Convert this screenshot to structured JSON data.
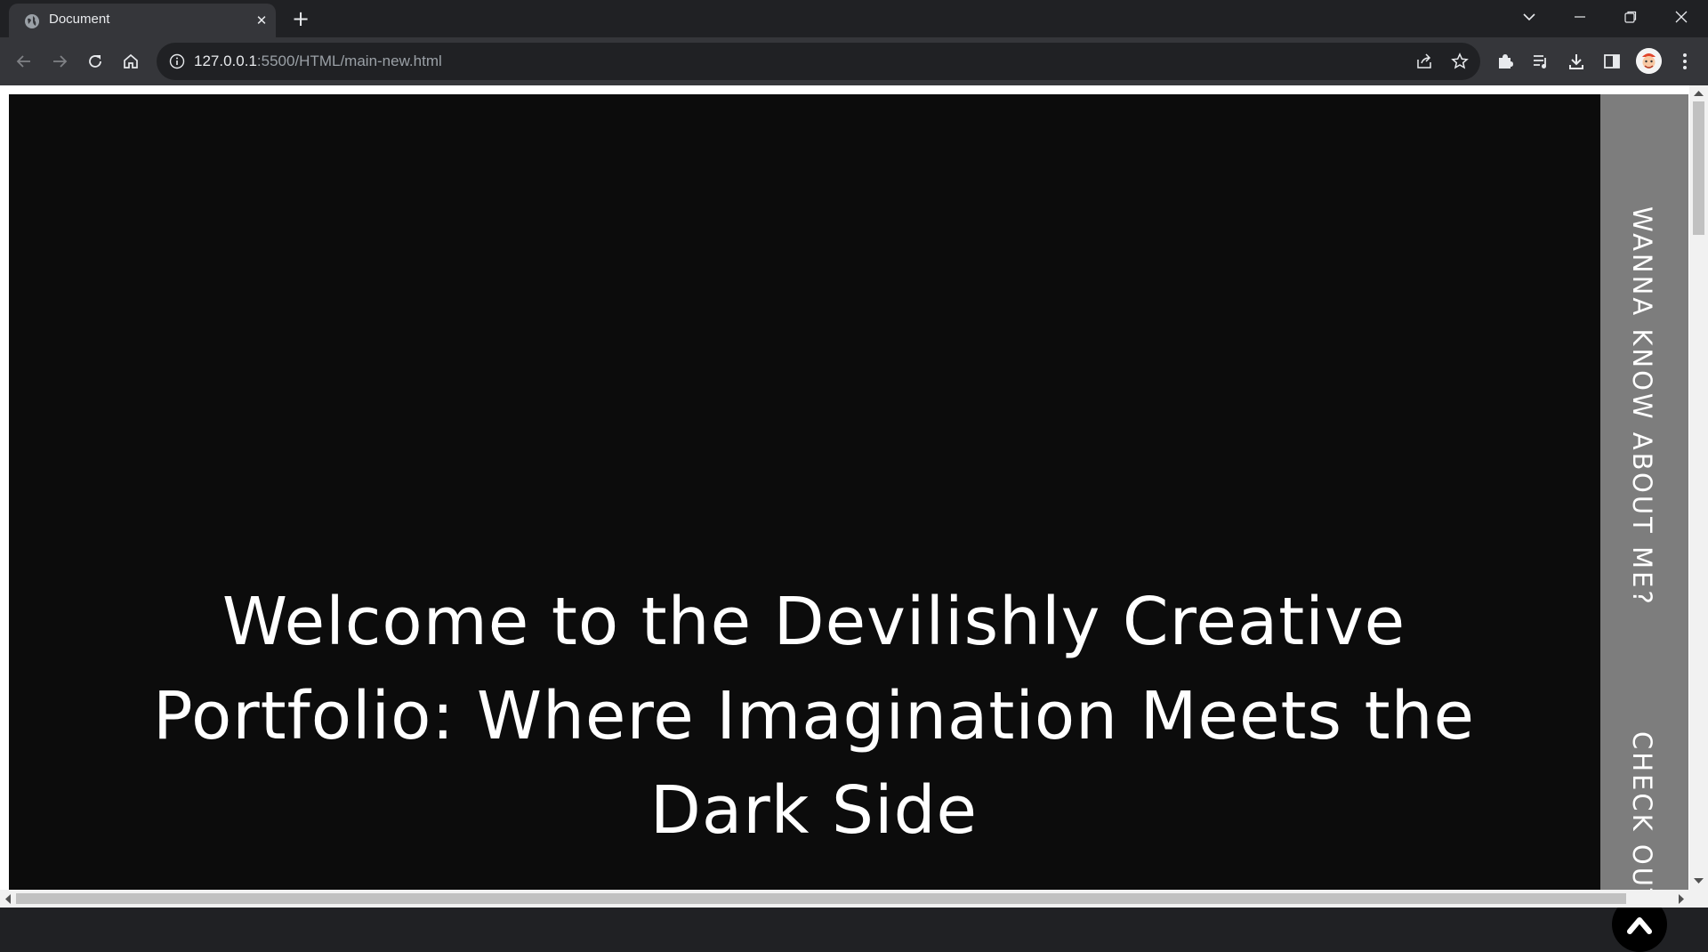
{
  "browser": {
    "tab_title": "Document",
    "url_host": "127.0.0.1",
    "url_rest": ":5500/HTML/main-new.html"
  },
  "page": {
    "hero_heading": "Welcome to the Devilishly Creative Portfolio: Where Imagination Meets the Dark Side",
    "side_links": {
      "about": "WANNA KNOW ABOUT ME?",
      "check": "CHECK OUT"
    }
  },
  "colors": {
    "hero_bg": "#0c0c0c",
    "side_panel_bg": "#7d7d7d",
    "browser_frame": "#202124",
    "toolbar": "#35363a"
  },
  "icons": {
    "tab_favicon": "globe-icon",
    "back": "arrow-left-icon",
    "forward": "arrow-right-icon",
    "reload": "reload-icon",
    "home": "home-icon",
    "site_info": "info-icon",
    "share": "share-icon",
    "bookmark": "star-icon",
    "extensions": "puzzle-icon",
    "media": "media-queue-icon",
    "downloads": "download-icon",
    "side_panel": "side-panel-icon",
    "menu": "kebab-menu-icon",
    "to_top": "chevron-up-icon"
  }
}
